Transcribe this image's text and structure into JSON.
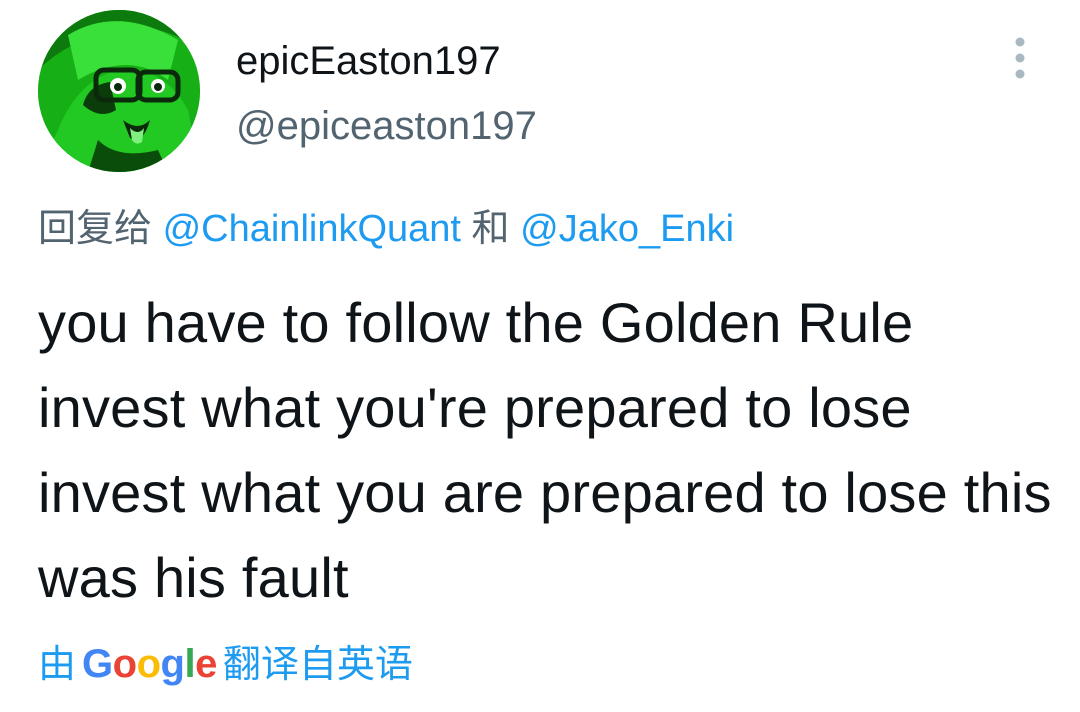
{
  "author": {
    "display_name": "epicEaston197",
    "handle": "@epiceaston197",
    "avatar_icon": "profile-avatar"
  },
  "more_icon": "more-vertical-icon",
  "reply": {
    "prefix": "回复给",
    "mention_1": "@ChainlinkQuant",
    "connector": "和",
    "mention_2": "@Jako_Enki"
  },
  "tweet_text": "you have to follow the Golden Rule invest what you're prepared to lose invest what you are prepared to lose this was his fault",
  "translation": {
    "prefix": "由",
    "brand": "Google",
    "suffix": "翻译自英语"
  },
  "colors": {
    "link": "#1d9bf0",
    "secondary_text": "#536471",
    "primary_text": "#0f1419",
    "avatar_green": "#1bbf1b"
  }
}
